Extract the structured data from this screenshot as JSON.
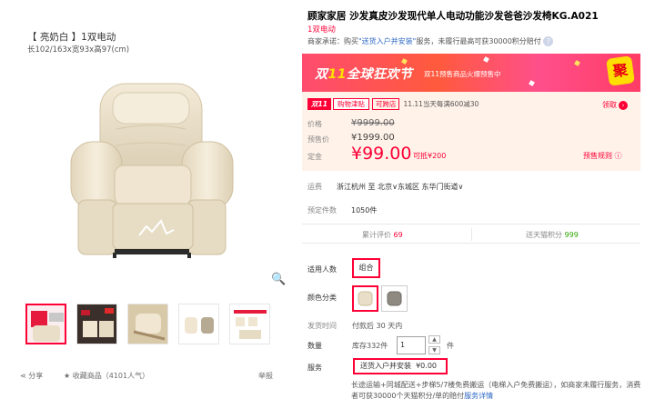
{
  "gallery": {
    "title": "【 亮奶白 】1双电动",
    "dims": "长102/163x宽93x高97(cm)",
    "zoom_icon": "magnifier-icon",
    "share": "分享",
    "favorite": "收藏商品（4101人气）",
    "report": "举报"
  },
  "product": {
    "title": "顾家家居 沙发真皮沙发现代单人电动功能沙发爸爸沙发椅KG.A021",
    "subtitle": "1双电动",
    "promise_prefix": "商家承诺：购买",
    "promise_link": "\"送货入户并安装\"",
    "promise_suffix": "服务，未履行最高可获30000积分赔付",
    "qmark": "?"
  },
  "banner": {
    "main_a": "双",
    "main_b": "11",
    "main_c": "全球狂欢节",
    "sub": "双11预售商品火爆预售中",
    "badge": "聚"
  },
  "price": {
    "tag_a": "双11",
    "tag_b": "购物津贴",
    "tag_c": "可跨店",
    "tag_text": "11.11当天每满600减30",
    "lingqu": "领取",
    "jiage_label": "价格",
    "jiage_value": "¥9999.00",
    "yugou_label": "预售价",
    "yugou_value": "¥1999.00",
    "dingjin_label": "定金",
    "dingjin_value": "¥99.00",
    "dingjin_deduct": "可抵¥200",
    "yushou_link": "预售规则"
  },
  "shipping": {
    "label": "运费",
    "value": "浙江杭州 至 北京∨东城区 东华门街道∨"
  },
  "presale": {
    "label": "预定件数",
    "value": "1050件"
  },
  "stats": {
    "reviews_label": "累计评价",
    "reviews_value": "69",
    "points_label": "送天猫积分",
    "points_value": "999"
  },
  "options": {
    "people_label": "适用人数",
    "people_value": "组合",
    "color_label": "颜色分类",
    "ship_label": "发货时间",
    "ship_value": "付款后 30 天内",
    "qty_label": "数量",
    "stock": "库存332件",
    "qty_value": "1",
    "qty_unit": "件",
    "service_label": "服务",
    "service_value": "送货入户并安装",
    "service_price": "¥0.00",
    "service_desc": "长途运输+同城配送+步梯5/7楼免费搬运（电梯入户免费搬运），如商家未履行服务，消费者可获30000个天猫积分/单的赔付",
    "service_link": "服务详情"
  }
}
